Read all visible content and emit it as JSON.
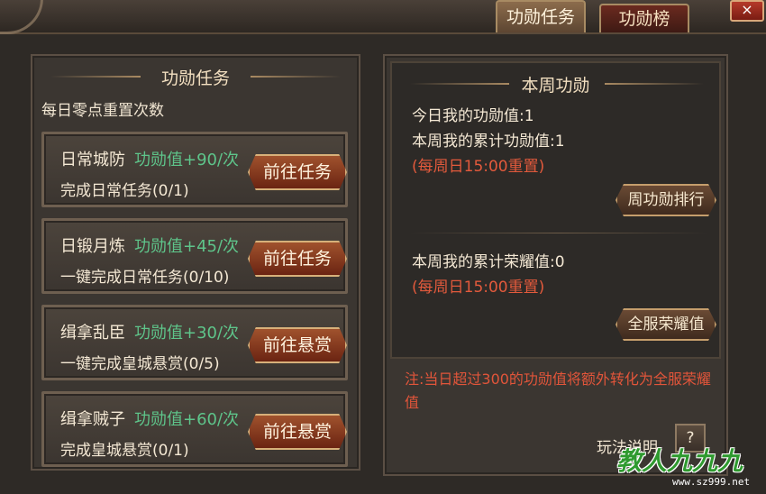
{
  "tabs": [
    {
      "label": "功勋任务",
      "active": true
    },
    {
      "label": "功勋榜",
      "active": false
    }
  ],
  "close_label": "×",
  "left": {
    "title": "功勋任务",
    "subtitle": "每日零点重置次数",
    "tasks": [
      {
        "name": "日常城防",
        "reward": "功勋值+90/次",
        "desc": "完成日常任务(0/1)",
        "button": "前往任务"
      },
      {
        "name": "日锻月炼",
        "reward": "功勋值+45/次",
        "desc": "一键完成日常任务(0/10)",
        "button": "前往任务"
      },
      {
        "name": "缉拿乱臣",
        "reward": "功勋值+30/次",
        "desc": "一键完成皇城悬赏(0/5)",
        "button": "前往悬赏"
      },
      {
        "name": "缉拿贼子",
        "reward": "功勋值+60/次",
        "desc": "完成皇城悬赏(0/1)",
        "button": "前往悬赏"
      }
    ]
  },
  "right": {
    "title": "本周功勋",
    "today_merit": "今日我的功勋值:1",
    "week_merit": "本周我的累计功勋值:1",
    "reset1": "(每周日15:00重置)",
    "rank_button": "周功勋排行",
    "week_honor": "本周我的累计荣耀值:0",
    "reset2": "(每周日15:00重置)",
    "honor_button": "全服荣耀值",
    "note": "注:当日超过300的功勋值将额外转化为全服荣耀值",
    "howto": "玩法说明",
    "help": "?"
  },
  "watermark": {
    "main": "教人九九九",
    "url": "www.sz999.net"
  },
  "colors": {
    "reward_green": "#5ec48a",
    "reset_red": "#e35a3c",
    "accent_gold": "#c59e6c"
  }
}
